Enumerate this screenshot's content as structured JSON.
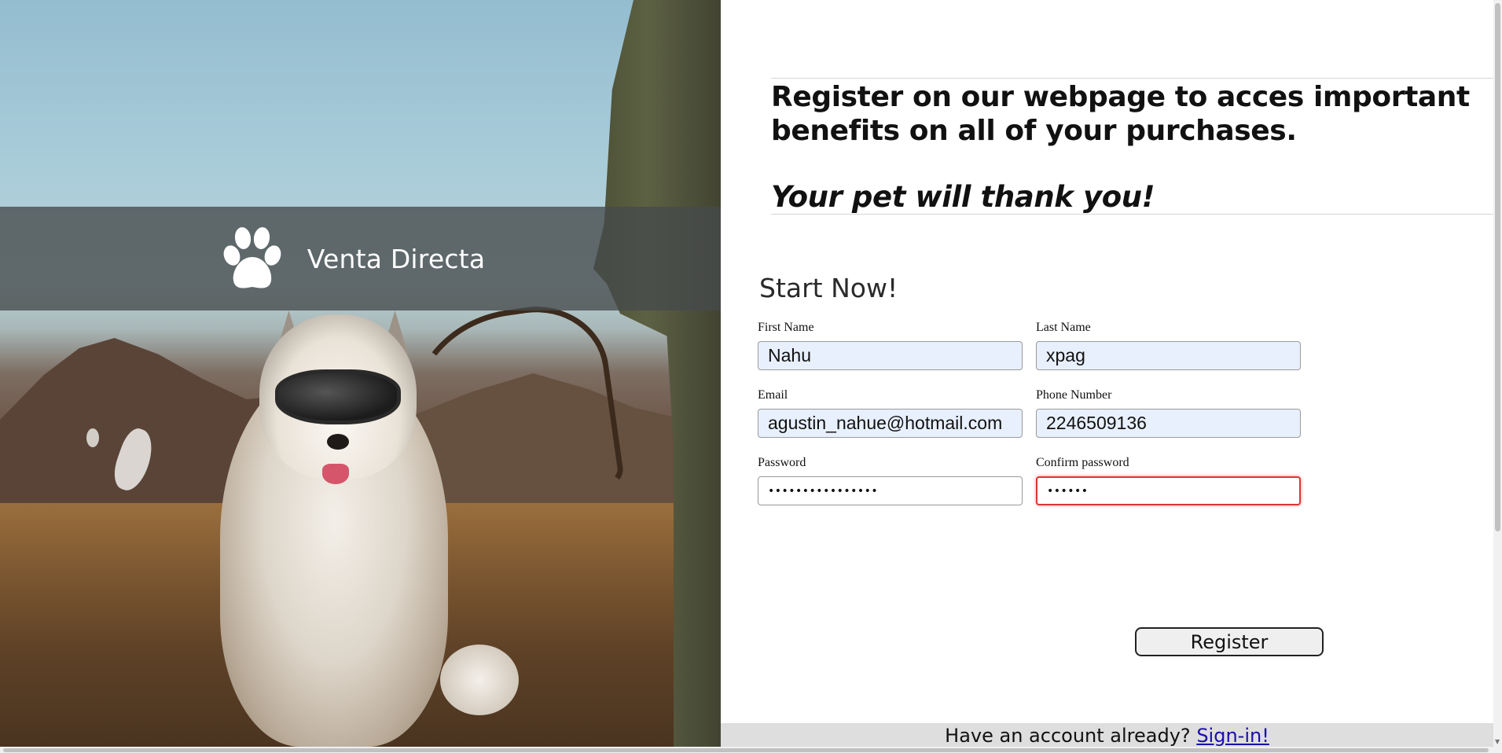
{
  "brand": {
    "name": "Venta Directa",
    "logo_icon": "paw-icon"
  },
  "headline": {
    "lead": "Register on our webpage to acces important benefits on all of your purchases.",
    "tagline": "Your pet will thank you!"
  },
  "form": {
    "title": "Start Now!",
    "first_name": {
      "label": "First Name",
      "value": "Nahu"
    },
    "last_name": {
      "label": "Last Name",
      "value": "xpag"
    },
    "email": {
      "label": "Email",
      "value": "agustin_nahue@hotmail.com"
    },
    "phone": {
      "label": "Phone Number",
      "value": "2246509136"
    },
    "password": {
      "label": "Password",
      "masked_value": "••••••••••••••••"
    },
    "confirm_password": {
      "label": "Confirm password",
      "masked_value": "••••••",
      "state": "invalid"
    },
    "submit_label": "Register"
  },
  "footer": {
    "prompt": "Have an account already?",
    "link_label": "Sign-in!"
  },
  "colors": {
    "banner_overlay": "#464a4c",
    "autofill_bg": "#e8f0fe",
    "invalid_border": "#e03434",
    "link": "#1a0dab",
    "footer_bg": "#dedede"
  }
}
